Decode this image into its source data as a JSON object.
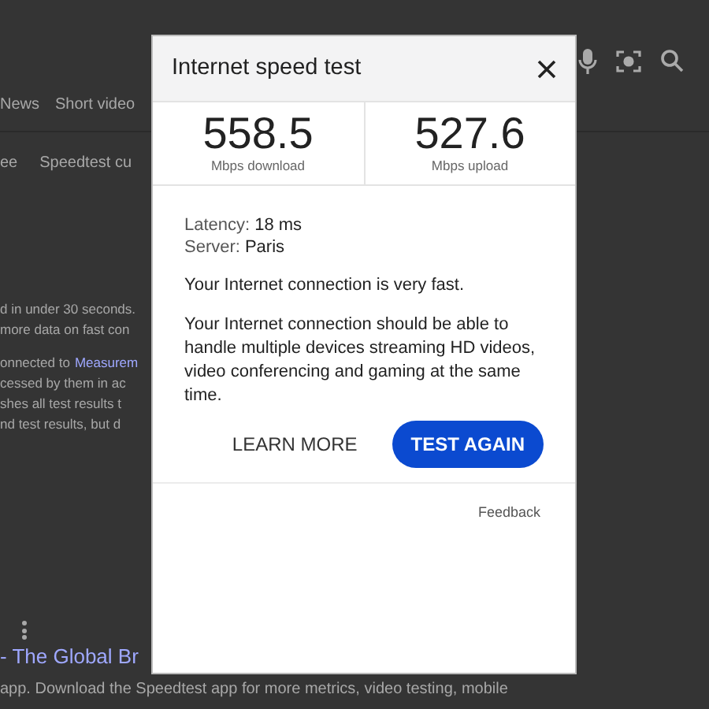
{
  "background": {
    "tabs": [
      "News",
      "Short video"
    ],
    "chips": [
      "ee",
      "Speedtest cu"
    ],
    "snippet_1": [
      "d in under 30 seconds.",
      "more data on fast con"
    ],
    "snippet_2_first": {
      "text": "onnected to",
      "link": "Measurem"
    },
    "snippet_2": [
      "cessed by them in ac",
      "shes all test results t",
      "nd test results, but d"
    ],
    "result": {
      "link": "- The Global Br",
      "description": "app. Download the Speedtest app for more metrics, video testing, mobile"
    }
  },
  "dialog": {
    "title": "Internet speed test",
    "speeds": [
      {
        "value": "558.5",
        "unit": "Mbps download"
      },
      {
        "value": "527.6",
        "unit": "Mbps upload"
      }
    ],
    "details": [
      {
        "label": "Latency:",
        "value": "18 ms"
      },
      {
        "label": "Server:",
        "value": "Paris"
      }
    ],
    "summary": "Your Internet connection is very fast.",
    "description": "Your Internet connection should be able to handle multiple devices streaming HD videos, video conferencing and gaming at the same time.",
    "buttons": [
      {
        "label": "LEARN MORE",
        "kind": "text"
      },
      {
        "label": "TEST AGAIN",
        "kind": "filled"
      }
    ],
    "feedback": "Feedback"
  }
}
